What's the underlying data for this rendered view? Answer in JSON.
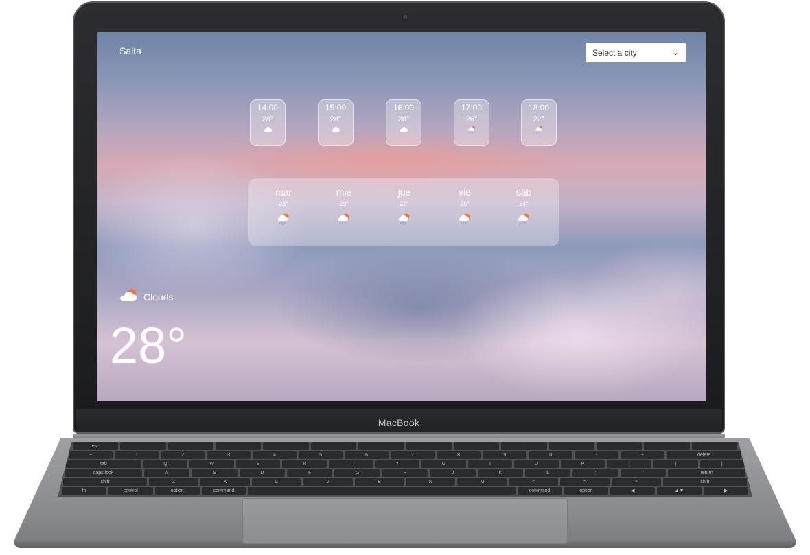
{
  "device": {
    "brand": "MacBook"
  },
  "app": {
    "city_name": "Salta",
    "city_select": {
      "label": "Select a city",
      "icon": "chevron-down-icon"
    },
    "hourly": [
      {
        "time": "14:00",
        "temp": "28°",
        "icon": "cloud-icon"
      },
      {
        "time": "15:00",
        "temp": "28°",
        "icon": "cloud-icon"
      },
      {
        "time": "16:00",
        "temp": "28°",
        "icon": "cloud-icon"
      },
      {
        "time": "17:00",
        "temp": "26°",
        "icon": "rain-sun-icon"
      },
      {
        "time": "18:00",
        "temp": "22°",
        "icon": "rain-sun-icon"
      }
    ],
    "daily": [
      {
        "day": "mar",
        "temp": "28°",
        "icon": "rain-sun-icon"
      },
      {
        "day": "mié",
        "temp": "29°",
        "icon": "rain-sun-icon"
      },
      {
        "day": "jue",
        "temp": "27°",
        "icon": "rain-sun-icon"
      },
      {
        "day": "vie",
        "temp": "26°",
        "icon": "rain-sun-icon"
      },
      {
        "day": "sáb",
        "temp": "24°",
        "icon": "rain-sun-icon"
      }
    ],
    "current": {
      "condition": "Clouds",
      "icon": "cloud-sun-icon",
      "temp": "28°"
    }
  },
  "keyboard": {
    "row0": [
      "esc",
      "",
      "",
      "",
      "",
      "",
      "",
      "",
      "",
      "",
      "",
      "",
      "",
      ""
    ],
    "row1": [
      "~",
      "1",
      "2",
      "3",
      "4",
      "5",
      "6",
      "7",
      "8",
      "9",
      "0",
      "-",
      "+",
      "delete"
    ],
    "row2": [
      "tab",
      "Q",
      "W",
      "E",
      "R",
      "T",
      "Y",
      "U",
      "I",
      "O",
      "P",
      "{",
      "}",
      "|"
    ],
    "row3": [
      "caps lock",
      "A",
      "S",
      "D",
      "F",
      "G",
      "H",
      "J",
      "K",
      "L",
      ":",
      "\"",
      "return"
    ],
    "row4": [
      "shift",
      "Z",
      "X",
      "C",
      "V",
      "B",
      "N",
      "M",
      "<",
      ">",
      "?",
      "shift"
    ],
    "row5": [
      "fn",
      "control",
      "option",
      "command",
      "",
      "command",
      "option",
      "◀",
      "▲▼",
      "▶"
    ]
  },
  "colors": {
    "sun_accent": "#f0763b",
    "rain_accent": "#8fa3c7"
  }
}
